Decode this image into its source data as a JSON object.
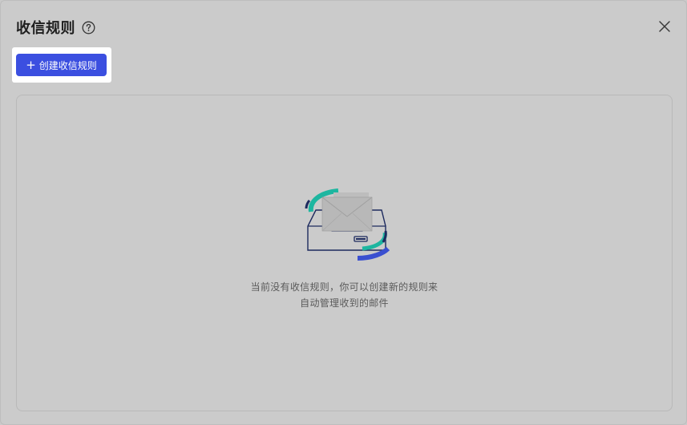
{
  "dialog": {
    "title": "收信规则",
    "create_button_label": "创建收信规则",
    "empty_state_text": "当前没有收信规则，你可以创建新的规则来自动管理收到的邮件"
  },
  "icons": {
    "help": "question-circle-icon",
    "close": "close-x-icon",
    "add": "plus-icon",
    "illustration": "mail-inbox-illustration"
  },
  "colors": {
    "primary": "#3b4fe0",
    "accent_teal": "#1db6a0",
    "accent_navy": "#1d2a5e",
    "accent_blue": "#3a4fd0"
  }
}
